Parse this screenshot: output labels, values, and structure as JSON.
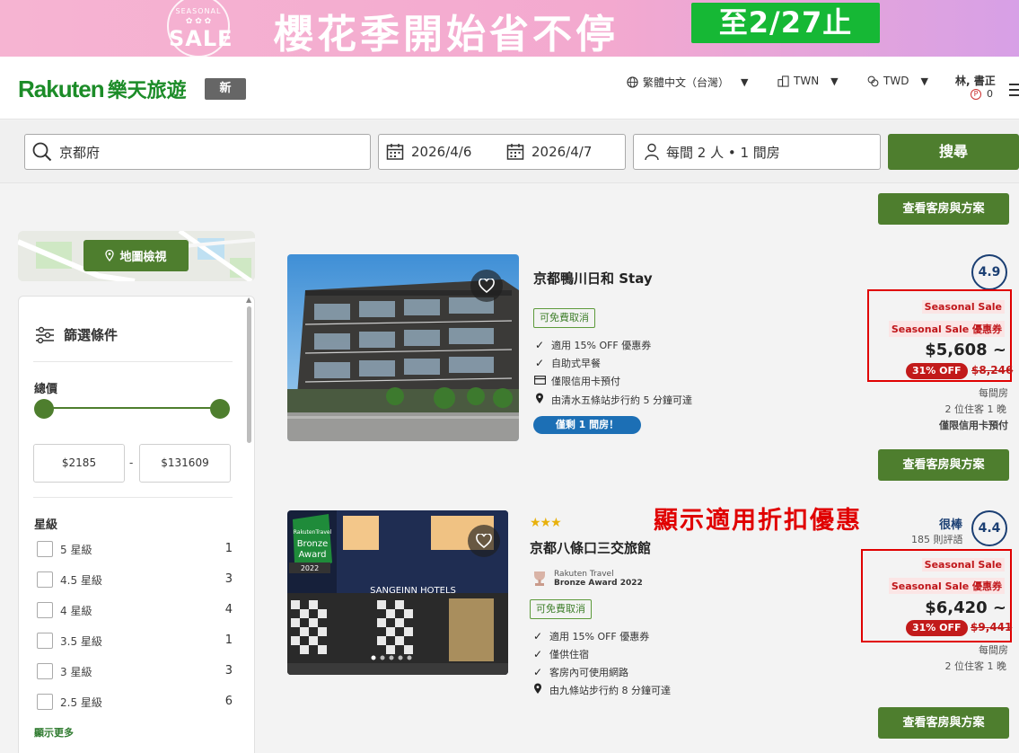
{
  "banner": {
    "badge_top": "SEASONAL",
    "badge_main": "SALE",
    "title": "櫻花季開始省不停",
    "cta": "至2/27止",
    "colors": {
      "cta_bg": "#16b835",
      "bg_start": "#f6b4d2",
      "bg_end": "#d7a0e6"
    }
  },
  "header": {
    "logo_en": "Rakuten",
    "logo_zh": "樂天旅遊",
    "new_badge": "新",
    "language": "繁體中文（台灣）",
    "region": "TWN",
    "currency": "TWD",
    "user_name": "林, 書正",
    "points": "0",
    "points_icon": "P",
    "brand_color": "#1c8c28"
  },
  "search": {
    "destination": "京都府",
    "checkin": "2026/4/6",
    "checkout": "2026/4/7",
    "guests": "每間 2 人 • 1 間房",
    "button": "搜尋"
  },
  "view_rooms_label": "查看客房與方案",
  "map": {
    "button": "地圖檢視"
  },
  "filter": {
    "title": "篩選條件",
    "total_price_label": "總價",
    "price_min": "$2185",
    "price_sep": "-",
    "price_max": "$131609",
    "star_label": "星級",
    "stars": [
      {
        "label": "5 星級",
        "count": "1"
      },
      {
        "label": "4.5 星級",
        "count": "3"
      },
      {
        "label": "4 星級",
        "count": "4"
      },
      {
        "label": "3.5 星級",
        "count": "1"
      },
      {
        "label": "3 星級",
        "count": "3"
      },
      {
        "label": "2.5 星級",
        "count": "6"
      }
    ],
    "show_more": "顯示更多"
  },
  "hotels": [
    {
      "name": "京都鴨川日和 Stay",
      "free_cancel": "可免費取消",
      "features": [
        "適用 15% OFF 優惠券",
        "自助式早餐",
        "僅限信用卡預付",
        "由清水五條站步行約 5 分鐘可達"
      ],
      "rooms_left": "僅剩 1 間房！",
      "rating": "4.9",
      "sale_tag": "Seasonal Sale",
      "coupon_tag": "Seasonal Sale 優惠券",
      "price": "$5,608 ~",
      "discount": "31% OFF",
      "original_price": "$8,246",
      "per_room": "每間房",
      "guests_nights": "2 位住客 1 晚",
      "payment_note": "僅限信用卡預付"
    },
    {
      "name": "京都八條口三交旅館",
      "stars": "★★★",
      "award_line1": "Rakuten Travel",
      "award_line2": "Bronze Award 2022",
      "photo_award_line1": "RakutenTravel",
      "photo_award_line2": "Bronze",
      "photo_award_line3": "Award",
      "photo_award_year": "2022",
      "photo_sign": "SANGEINN HOTELS",
      "free_cancel": "可免費取消",
      "features": [
        "適用 15% OFF 優惠券",
        "僅供住宿",
        "客房內可使用網路",
        "由九條站步行約 8 分鐘可達"
      ],
      "grade": "很棒",
      "reviews": "185 則評語",
      "rating": "4.4",
      "sale_tag": "Seasonal Sale",
      "coupon_tag": "Seasonal Sale 優惠券",
      "price": "$6,420 ~",
      "discount": "31% OFF",
      "original_price": "$9,441",
      "per_room": "每間房",
      "guests_nights": "2 位住客 1 晚"
    }
  ],
  "annotation": "顯示適用折扣優惠",
  "colors": {
    "primary_green": "#4e7e2e",
    "highlight_red": "#e00000",
    "rating_blue": "#1b3f73",
    "rooms_left_blue": "#1c6fb5"
  }
}
